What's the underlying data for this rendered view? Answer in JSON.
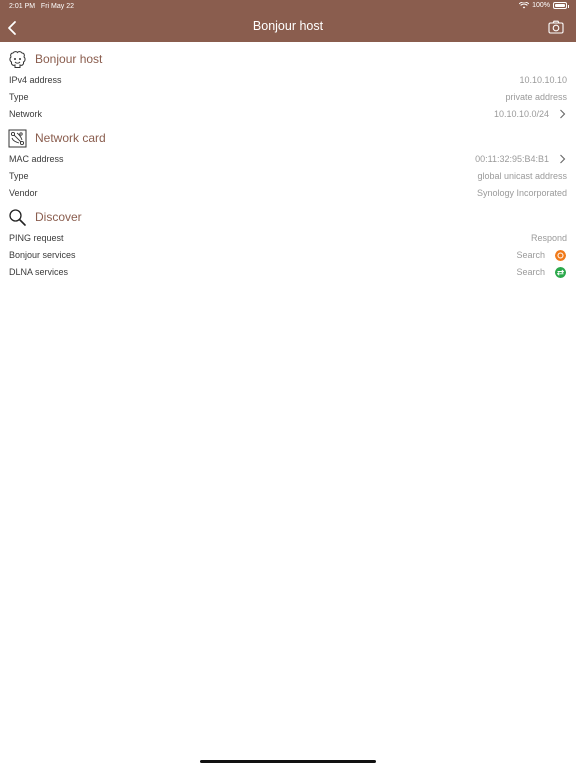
{
  "status_bar": {
    "time": "2:01 PM",
    "date": "Fri May 22",
    "battery": "100%"
  },
  "nav": {
    "title": "Bonjour host"
  },
  "sections": [
    {
      "title": "Bonjour host",
      "icon": "bonjour-icon",
      "rows": [
        {
          "label": "IPv4 address",
          "value": "10.10.10.10"
        },
        {
          "label": "Type",
          "value": "private address"
        },
        {
          "label": "Network",
          "value": "10.10.10.0/24"
        }
      ]
    },
    {
      "title": "Network card",
      "icon": "network-card-icon",
      "rows": [
        {
          "label": "MAC address",
          "value": "00:11:32:95:B4:B1"
        },
        {
          "label": "Type",
          "value": "global unicast address"
        },
        {
          "label": "Vendor",
          "value": "Synology Incorporated"
        }
      ]
    },
    {
      "title": "Discover",
      "icon": "magnifier-icon",
      "rows": [
        {
          "label": "PING request",
          "value": "Respond"
        },
        {
          "label": "Bonjour services",
          "value": "Search"
        },
        {
          "label": "DLNA services",
          "value": "Search"
        }
      ]
    }
  ],
  "colors": {
    "header": "#8a5d4e",
    "accent_title": "#8a5d4e",
    "bonjour_badge": "#f07a1a",
    "dlna_badge": "#2aa84a"
  }
}
